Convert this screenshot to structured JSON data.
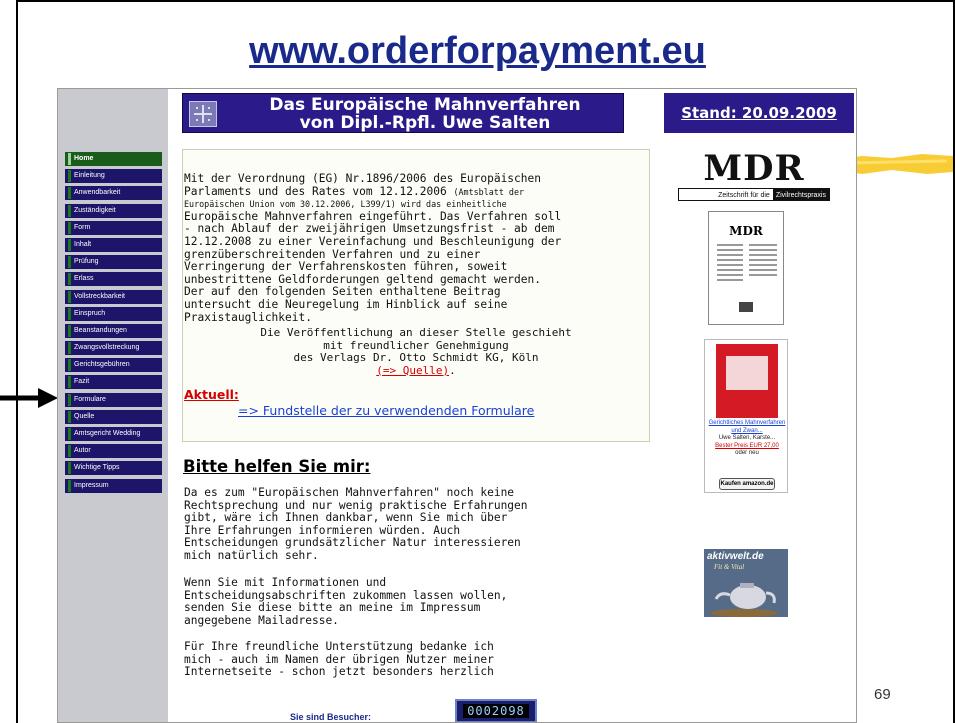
{
  "slide": {
    "title": "www.orderforpayment.eu",
    "page_number": "69"
  },
  "site": {
    "banner": {
      "line1": "Das Europäische Mahnverfahren",
      "line2": "von Dipl.-Rpfl. Uwe Salten"
    },
    "stand": "Stand: 20.09.2009",
    "nav": [
      "Home",
      "Einleitung",
      "Anwendbarkeit",
      "Zuständigkeit",
      "Form",
      "Inhalt",
      "Prüfung",
      "Erlass",
      "Vollstreckbarkeit",
      "Einspruch",
      "Beanstandungen",
      "Zwangsvollstreckung",
      "Gerichtsgebühren",
      "Fazit",
      "Formulare",
      "Quelle",
      "Amtsgericht Wedding",
      "Autor",
      "Wichtige Tipps",
      "Impressum"
    ],
    "intro": {
      "lines": [
        "Mit der Verordnung (EG) Nr.1896/2006 des Europäischen",
        "Parlaments und des Rates vom 12.12.2006",
        "Europäischen Union vom 30.12.2006, L399/1) wird das einheitliche",
        "Europäische Mahnverfahren eingeführt. Das Verfahren soll",
        "- nach Ablauf der zweijährigen Umsetzungsfrist - ab dem",
        "12.12.2008 zu einer Vereinfachung und Beschleunigung der",
        "grenzüberschreitenden Verfahren und zu einer",
        "Verringerung der Verfahrenskosten führen, soweit",
        "unbestrittene Geldforderungen geltend gemacht werden.",
        "Der auf den folgenden Seiten enthaltene Beitrag",
        "untersucht die Neuregelung im Hinblick auf seine",
        "Praxistauglichkeit."
      ],
      "small_note": "(Amtsblatt der",
      "publication_line1": "Die Veröffentlichung an dieser Stelle geschieht",
      "publication_line2": "mit freundlicher Genehmigung",
      "publication_line3": "des Verlags Dr. Otto Schmidt KG, Köln",
      "source_link": "(=> Quelle)",
      "source_suffix": "."
    },
    "aktuell": {
      "heading": "Aktuell:",
      "link": "=> Fundstelle der zu verwendenden Formulare"
    },
    "help": {
      "heading": "Bitte helfen Sie mir:",
      "p1": [
        "Da es zum \"Europäischen Mahnverfahren\" noch keine",
        "Rechtsprechung und nur wenig praktische Erfahrungen",
        "gibt, wäre ich Ihnen dankbar, wenn Sie mich über",
        "Ihre Erfahrungen informieren würden. Auch",
        "Entscheidungen grundsätzlicher Natur interessieren",
        "mich natürlich sehr."
      ],
      "p2": [
        "Wenn Sie mit Informationen und",
        "Entscheidungsabschriften zukommen lassen wollen,",
        "senden Sie diese bitte an meine im Impressum",
        "angegebene Mailadresse."
      ],
      "p3": [
        "Für Ihre freundliche Unterstützung bedanke ich",
        "mich  - auch im Namen der übrigen Nutzer meiner",
        "Internetseite - schon jetzt besonders herzlich"
      ]
    },
    "visitor": {
      "label": "Sie sind Besucher:",
      "count": "0002098"
    },
    "sidebar_right": {
      "mdr_word": "MDR",
      "mdr_sub_left": "Zeitschrift für die",
      "mdr_sub_right": "Zivilrechtspraxis",
      "mdr_cover_title": "MDR",
      "book_title": "Gerichtliches Mahnverfahren und Zwan...",
      "book_author": "Uwe Salten, Karste...",
      "book_price": "Bester Preis EUR 27,00",
      "book_or": "oder neu",
      "buy_label": "Kaufen amazon.de",
      "aktivwelt_name": "aktivwelt.de",
      "aktivwelt_tag": "Fit & Vital"
    }
  },
  "colors": {
    "title_blue": "#1a2a8a",
    "banner_purple": "#2a1a8a",
    "nav_bg": "#1c1569",
    "accent_red": "#d40000",
    "link_blue": "#1a3fd6"
  }
}
